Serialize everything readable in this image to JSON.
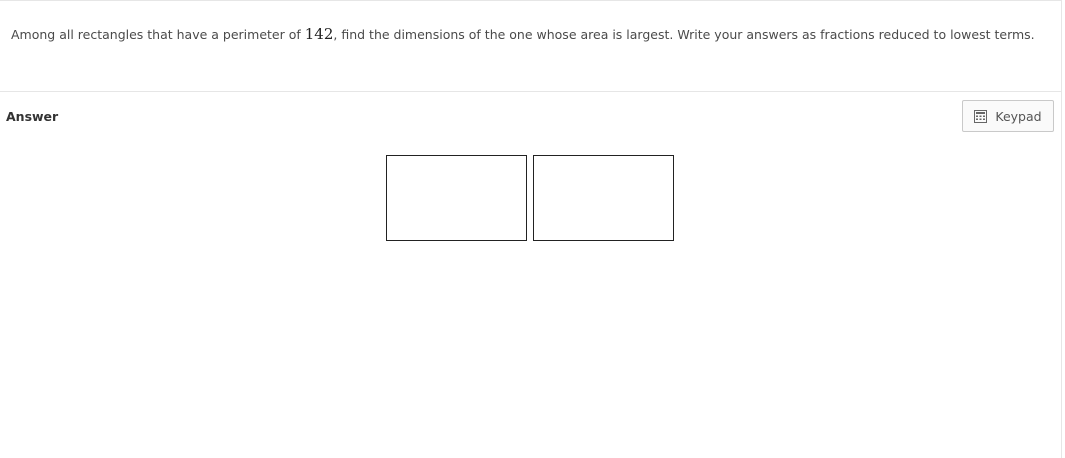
{
  "question": {
    "text_before": "Among all rectangles that have a perimeter of ",
    "perimeter": "142",
    "text_after": ", find the dimensions of the one whose area is largest.  Write your answers as fractions reduced to lowest terms."
  },
  "answer": {
    "label": "Answer",
    "keypad_label": "Keypad",
    "keypad_icon": "calculator-grid-icon",
    "inputs": [
      {
        "value": "",
        "placeholder": ""
      },
      {
        "value": "",
        "placeholder": ""
      }
    ]
  }
}
